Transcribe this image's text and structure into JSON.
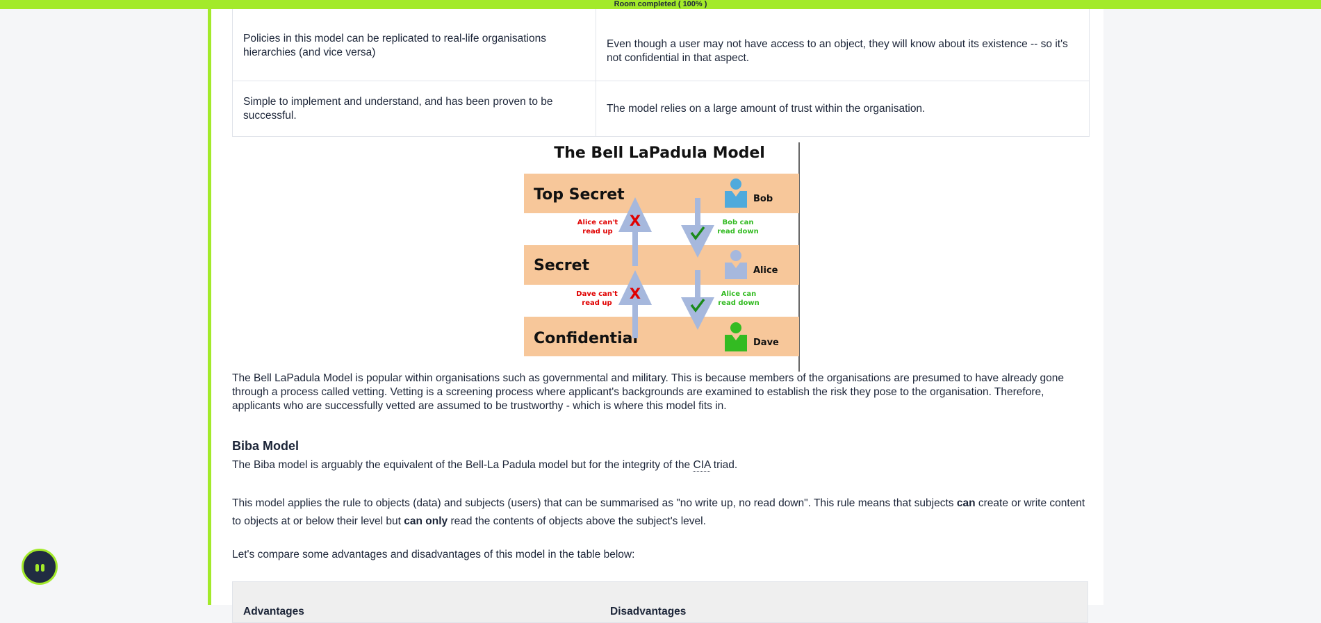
{
  "progress": {
    "label": "Room completed ( 100% )",
    "value": 1.0
  },
  "top_table": {
    "rows": [
      {
        "left": "Policies in this model can be replicated to real-life organisations hierarchies (and vice versa)",
        "right": "Even though a user may not have access to an object, they will know about its existence -- so it's not confidential in that aspect."
      },
      {
        "left": "Simple to implement and understand, and has been proven to be successful.",
        "right": "The model relies on a large amount of trust within the organisation."
      }
    ]
  },
  "diagram": {
    "title": "The Bell LaPadula Model",
    "levels": [
      "Top Secret",
      "Secret",
      "Confidential"
    ],
    "users": [
      "Bob",
      "Alice",
      "Dave"
    ],
    "deny_labels": [
      [
        "Alice can't",
        "read up"
      ],
      [
        "Dave can't",
        "read up"
      ]
    ],
    "allow_labels": [
      [
        "Bob can",
        "read down"
      ],
      [
        "Alice can",
        "read down"
      ]
    ],
    "deny_mark": "X",
    "colors": {
      "band": "#f7c79a",
      "arrow": "#a6b8dd",
      "deny": "#e00000",
      "allow": "#33bb22",
      "bob": "#4faadc",
      "alice": "#a6b8dd",
      "dave": "#33bb22"
    }
  },
  "bell_paragraph": "The Bell LaPadula Model is popular within organisations such as governmental and military. This is because members of the organisations are presumed to have already gone through a process called vetting. Vetting is a screening process where applicant's backgrounds are examined to establish the risk they pose to the organisation. Therefore, applicants who are successfully vetted are assumed to be trustworthy - which is where this model fits in.",
  "biba": {
    "heading": "Biba Model",
    "intro_before": "The Biba model is arguably the equivalent of the Bell-La Padula model but for the integrity of the ",
    "intro_abbr": "CIA",
    "intro_after": " triad.",
    "rule_1": "This model applies the rule to objects (data) and subjects (users) that can be summarised as \"no write up, no read down\". This rule means that subjects ",
    "rule_bold_1": "can",
    "rule_2": " create or write content to objects at or below their level but ",
    "rule_bold_2": "can only",
    "rule_3": " read the contents of objects above the subject's level.",
    "compare": "Let's compare some advantages and disadvantages of this model in the table below:"
  },
  "bottom_table": {
    "headers": [
      "Advantages",
      "Disadvantages"
    ]
  },
  "icons": {
    "chat": "assistant-bot-icon"
  }
}
